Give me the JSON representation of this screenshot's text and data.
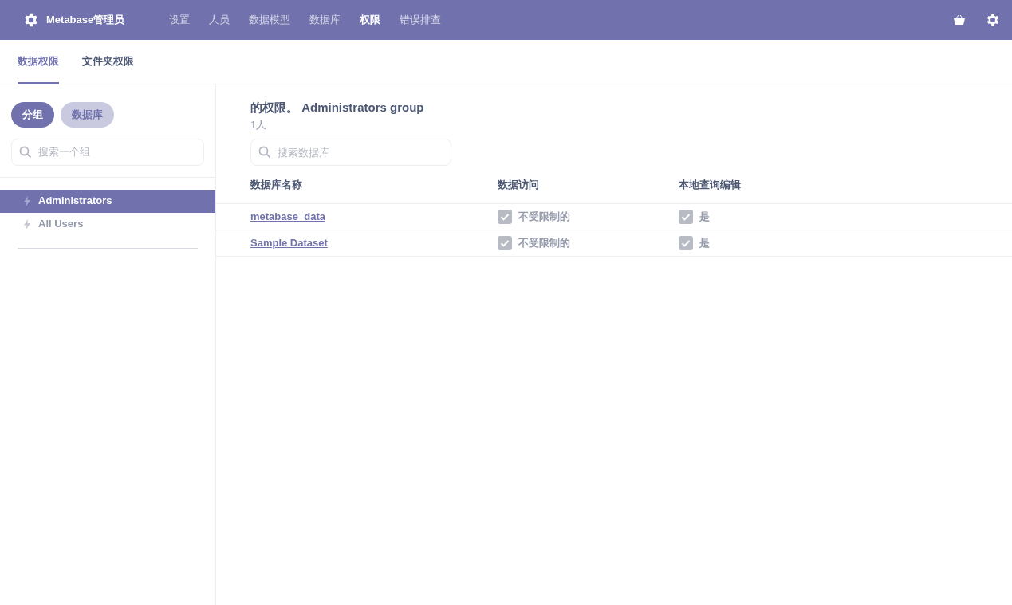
{
  "navbar": {
    "brand": "Metabase管理员",
    "items": [
      {
        "label": "设置",
        "selected": false
      },
      {
        "label": "人员",
        "selected": false
      },
      {
        "label": "数据模型",
        "selected": false
      },
      {
        "label": "数据库",
        "selected": false
      },
      {
        "label": "权限",
        "selected": true
      },
      {
        "label": "错误排查",
        "selected": false
      }
    ]
  },
  "tabs": [
    {
      "label": "数据权限",
      "selected": true
    },
    {
      "label": "文件夹权限",
      "selected": false
    }
  ],
  "sidebar": {
    "toggles": [
      {
        "label": "分组",
        "selected": true
      },
      {
        "label": "数据库",
        "selected": false
      }
    ],
    "search": {
      "placeholder": "搜索一个组"
    },
    "items": [
      {
        "label": "Administrators",
        "selected": true
      },
      {
        "label": "All Users",
        "selected": false
      }
    ]
  },
  "main": {
    "title_prefix": "的权限。",
    "title_group": "Administrators group",
    "member_count": "1人",
    "search": {
      "placeholder": "搜索数据库"
    },
    "table": {
      "columns": [
        "数据库名称",
        "数据访问",
        "本地查询编辑"
      ],
      "rows": [
        {
          "name": "metabase_data",
          "access": "不受限制的",
          "native": "是"
        },
        {
          "name": "Sample Dataset",
          "access": "不受限制的",
          "native": "是"
        }
      ]
    }
  }
}
